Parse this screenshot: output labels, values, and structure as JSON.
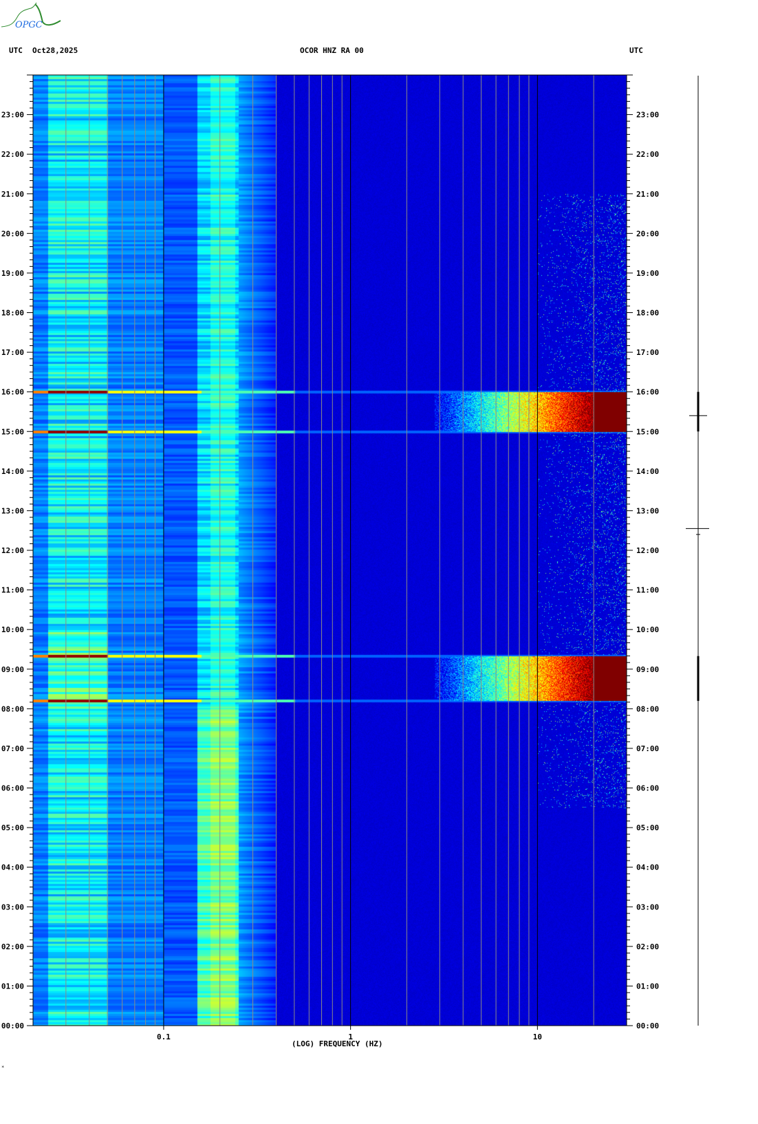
{
  "header": {
    "left_tz": "UTC",
    "date": "Oct28,2025",
    "station": "OCOR HNZ RA 00",
    "right_tz": "UTC"
  },
  "logo": {
    "text": "OPGC"
  },
  "footer_mark": "*",
  "chart_data": {
    "type": "heatmap",
    "title": "OCOR HNZ RA 00",
    "xlabel": "(LOG) FREQUENCY (HZ)",
    "ylabel": "UTC",
    "x_scale": "log",
    "xlim": [
      0.02,
      30
    ],
    "ylim_hours": [
      0,
      24
    ],
    "x_tick_labels": [
      {
        "value": 0.1,
        "label": "0.1"
      },
      {
        "value": 1,
        "label": "1"
      },
      {
        "value": 10,
        "label": "10"
      }
    ],
    "x_major_gridlines": [
      0.1,
      1,
      10
    ],
    "x_minor_gridlines": [
      0.03,
      0.04,
      0.05,
      0.06,
      0.07,
      0.08,
      0.09,
      0.2,
      0.3,
      0.4,
      0.5,
      0.6,
      0.7,
      0.8,
      0.9,
      2,
      3,
      4,
      5,
      6,
      7,
      8,
      9,
      20,
      30
    ],
    "y_tick_labels": [
      "00:00",
      "01:00",
      "02:00",
      "03:00",
      "04:00",
      "05:00",
      "06:00",
      "07:00",
      "08:00",
      "09:00",
      "10:00",
      "11:00",
      "12:00",
      "13:00",
      "14:00",
      "15:00",
      "16:00",
      "17:00",
      "18:00",
      "19:00",
      "20:00",
      "21:00",
      "22:00",
      "23:00"
    ],
    "colormap": "jet",
    "background_level": "low (dark blue) above 0.4 Hz",
    "bands": [
      {
        "freq_range_hz": [
          0.024,
          0.048
        ],
        "level": "medium (light blue)"
      },
      {
        "freq_range_hz": [
          0.15,
          0.25
        ],
        "level": "medium-high (cyan), strongest 00:00-08:00"
      }
    ],
    "events": [
      {
        "time_range_utc": [
          "15:00",
          "16:00"
        ],
        "freq_range_hz": [
          3,
          30
        ],
        "peak": "saturated above 20 Hz"
      },
      {
        "time_range_utc": [
          "08:10",
          "09:20"
        ],
        "freq_range_hz": [
          3,
          30
        ],
        "peak": "saturated above 20 Hz"
      }
    ],
    "horizontal_lines_utc": [
      "16:00",
      "15:00",
      "09:20",
      "08:10"
    ]
  }
}
